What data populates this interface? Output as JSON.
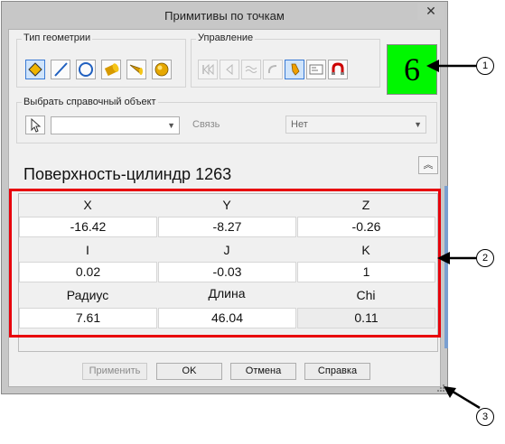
{
  "window": {
    "title": "Примитивы по точкам",
    "close_glyph": "✕"
  },
  "geometry_group": {
    "label": "Тип геометрии",
    "buttons": [
      "point-icon",
      "line-icon",
      "circle-icon",
      "cylinder-icon",
      "cone-icon",
      "sphere-icon"
    ],
    "selected": "point-icon"
  },
  "control_group": {
    "label": "Управление",
    "buttons": [
      "first-icon",
      "prev-icon",
      "wave-icon",
      "undo-icon",
      "probe-icon",
      "card-icon",
      "magnet-icon"
    ]
  },
  "counter": {
    "value": "6",
    "color": "#00f700"
  },
  "reference": {
    "label": "Выбрать справочный объект",
    "combo_value": "",
    "link_label": "Связь",
    "link_value": "Нет"
  },
  "heading": "Поверхность-цилиндр 1263",
  "collapse_glyph": "︽",
  "grid": {
    "row1": {
      "labels": [
        "X",
        "Y",
        "Z"
      ],
      "values": [
        "-16.42",
        "-8.27",
        "-0.26"
      ]
    },
    "row2": {
      "labels": [
        "I",
        "J",
        "K"
      ],
      "values": [
        "0.02",
        "-0.03",
        "1"
      ]
    },
    "row3": {
      "labels": [
        "Радиус",
        "Длина",
        "Chi"
      ],
      "values": [
        "7.61",
        "46.04",
        "0.11"
      ]
    }
  },
  "buttons": {
    "apply": "Применить",
    "ok": "OK",
    "cancel": "Отмена",
    "help": "Справка"
  },
  "callouts": [
    "1",
    "2",
    "3"
  ],
  "colors": {
    "highlight_frame": "#e8000b",
    "selected_button": "#cfe4fb"
  }
}
